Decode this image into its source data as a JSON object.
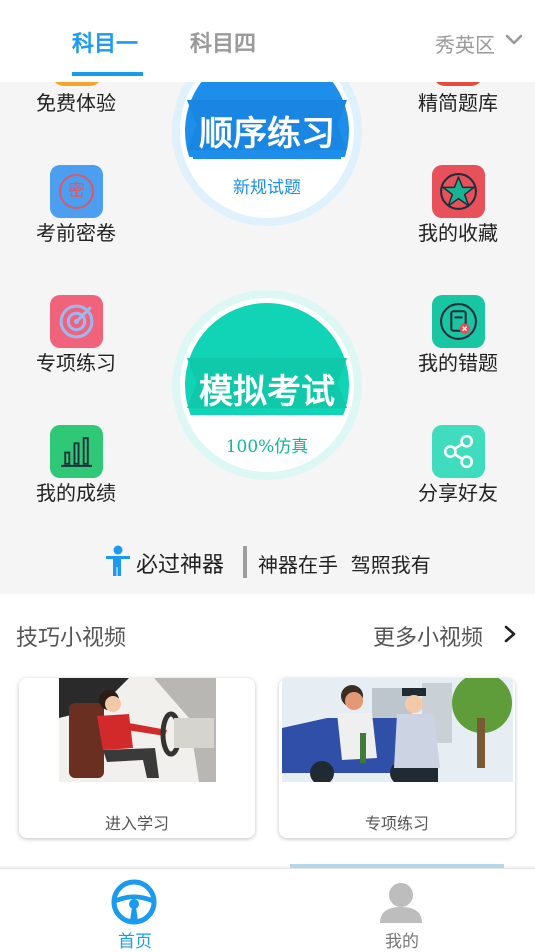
{
  "header": {
    "tabs": [
      {
        "label": "科目一",
        "active": true
      },
      {
        "label": "科目四",
        "active": false
      }
    ],
    "region": "秀英区",
    "region_icon": "chevron-down-icon"
  },
  "features": {
    "free_trial": {
      "label": "免费体验"
    },
    "selected_bank": {
      "label": "精简题库"
    },
    "pre_exam": {
      "label": "考前密卷",
      "icon": "secret-stamp-icon",
      "icon_glyph": "密"
    },
    "favorites": {
      "label": "我的收藏",
      "icon": "star-icon"
    },
    "special": {
      "label": "专项练习",
      "icon": "target-icon"
    },
    "mistakes": {
      "label": "我的错题",
      "icon": "wrong-doc-icon"
    },
    "scores": {
      "label": "我的成绩",
      "icon": "bar-chart-icon"
    },
    "share": {
      "label": "分享好友",
      "icon": "share-icon"
    }
  },
  "sequential": {
    "title": "顺序练习",
    "subtitle": "新规试题"
  },
  "mock_exam": {
    "title": "模拟考试",
    "subtitle": "100%仿真"
  },
  "slogan": {
    "main": "必过神器",
    "sub": "神器在手  驾照我有"
  },
  "videos": {
    "section_title": "技巧小视频",
    "more_label": "更多小视频",
    "cards": [
      {
        "caption": "进入学习"
      },
      {
        "caption": "专项练习"
      }
    ]
  },
  "bottom_nav": {
    "home": {
      "label": "首页",
      "active": true
    },
    "mine": {
      "label": "我的",
      "active": false
    }
  },
  "colors": {
    "accent": "#1a9bf0",
    "teal": "#11c7a8",
    "red": "#e84a55"
  }
}
